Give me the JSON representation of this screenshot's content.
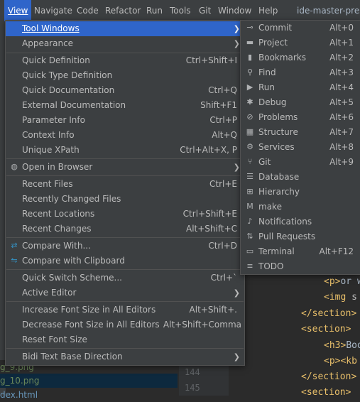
{
  "menubar": {
    "items": [
      "View",
      "Navigate",
      "Code",
      "Refactor",
      "Run",
      "Tools",
      "Git",
      "Window",
      "Help"
    ],
    "project_title": "ide-master-prese"
  },
  "project_panel": {
    "files": [
      "g_9.png",
      "g_10.png",
      "dex.html"
    ]
  },
  "editor": {
    "line_numbers": [
      "144",
      "145"
    ],
    "code": [
      {
        "tag": "<p>",
        "text": "or w"
      },
      {
        "tag": "<img",
        "text": " s"
      },
      {
        "tag": "</section>",
        "text": ""
      },
      {
        "tag": "<section>",
        "text": ""
      },
      {
        "tag": "<h3>",
        "text": "Boo"
      },
      {
        "tag": "<p><kb",
        "text": ""
      },
      {
        "tag": "</section>",
        "text": ""
      },
      {
        "tag": "<section>",
        "text": ""
      }
    ]
  },
  "view_menu": {
    "items": [
      {
        "label": "Tool Windows",
        "shortcut": "",
        "submenu": true
      },
      {
        "label": "Appearance",
        "shortcut": "",
        "submenu": true
      },
      {
        "label": "Quick Definition",
        "shortcut": "Ctrl+Shift+I"
      },
      {
        "label": "Quick Type Definition",
        "shortcut": ""
      },
      {
        "label": "Quick Documentation",
        "shortcut": "Ctrl+Q"
      },
      {
        "label": "External Documentation",
        "shortcut": "Shift+F1"
      },
      {
        "label": "Parameter Info",
        "shortcut": "Ctrl+P"
      },
      {
        "label": "Context Info",
        "shortcut": "Alt+Q"
      },
      {
        "label": "Unique XPath",
        "shortcut": "Ctrl+Alt+X, P"
      },
      {
        "label": "Open in Browser",
        "shortcut": "",
        "submenu": true
      },
      {
        "label": "Recent Files",
        "shortcut": "Ctrl+E"
      },
      {
        "label": "Recently Changed Files",
        "shortcut": ""
      },
      {
        "label": "Recent Locations",
        "shortcut": "Ctrl+Shift+E"
      },
      {
        "label": "Recent Changes",
        "shortcut": "Alt+Shift+C"
      },
      {
        "label": "Compare With...",
        "shortcut": "Ctrl+D"
      },
      {
        "label": "Compare with Clipboard",
        "shortcut": ""
      },
      {
        "label": "Quick Switch Scheme...",
        "shortcut": "Ctrl+`"
      },
      {
        "label": "Active Editor",
        "shortcut": "",
        "submenu": true
      },
      {
        "label": "Increase Font Size in All Editors",
        "shortcut": "Alt+Shift+."
      },
      {
        "label": "Decrease Font Size in All Editors",
        "shortcut": "Alt+Shift+Comma"
      },
      {
        "label": "Reset Font Size",
        "shortcut": ""
      },
      {
        "label": "Bidi Text Base Direction",
        "shortcut": "",
        "submenu": true
      }
    ]
  },
  "tool_windows_menu": {
    "items": [
      {
        "label": "Commit",
        "shortcut": "Alt+0",
        "icon": "commit-icon",
        "glyph": "⊸"
      },
      {
        "label": "Project",
        "shortcut": "Alt+1",
        "icon": "folder-icon",
        "glyph": "▬"
      },
      {
        "label": "Bookmarks",
        "shortcut": "Alt+2",
        "icon": "bookmark-icon",
        "glyph": "▮"
      },
      {
        "label": "Find",
        "shortcut": "Alt+3",
        "icon": "search-icon",
        "glyph": "⚲"
      },
      {
        "label": "Run",
        "shortcut": "Alt+4",
        "icon": "play-icon",
        "glyph": "▶"
      },
      {
        "label": "Debug",
        "shortcut": "Alt+5",
        "icon": "bug-icon",
        "glyph": "✱"
      },
      {
        "label": "Problems",
        "shortcut": "Alt+6",
        "icon": "warning-icon",
        "glyph": "⊘"
      },
      {
        "label": "Structure",
        "shortcut": "Alt+7",
        "icon": "structure-icon",
        "glyph": "▦"
      },
      {
        "label": "Services",
        "shortcut": "Alt+8",
        "icon": "services-icon",
        "glyph": "⚙"
      },
      {
        "label": "Git",
        "shortcut": "Alt+9",
        "icon": "git-icon",
        "glyph": "⑂"
      },
      {
        "label": "Database",
        "shortcut": "",
        "icon": "database-icon",
        "glyph": "☰"
      },
      {
        "label": "Hierarchy",
        "shortcut": "",
        "icon": "hierarchy-icon",
        "glyph": "⊞"
      },
      {
        "label": "make",
        "shortcut": "",
        "icon": "make-icon",
        "glyph": "M"
      },
      {
        "label": "Notifications",
        "shortcut": "",
        "icon": "bell-icon",
        "glyph": "♪"
      },
      {
        "label": "Pull Requests",
        "shortcut": "",
        "icon": "pull-request-icon",
        "glyph": "⇅"
      },
      {
        "label": "Terminal",
        "shortcut": "Alt+F12",
        "icon": "terminal-icon",
        "glyph": "▭"
      },
      {
        "label": "TODO",
        "shortcut": "",
        "icon": "todo-icon",
        "glyph": "≡"
      }
    ]
  },
  "colors": {
    "selection": "#2f65ca",
    "menu_bg": "#3c3f41",
    "editor_bg": "#2b2b2b",
    "tag": "#e8bf6a"
  }
}
